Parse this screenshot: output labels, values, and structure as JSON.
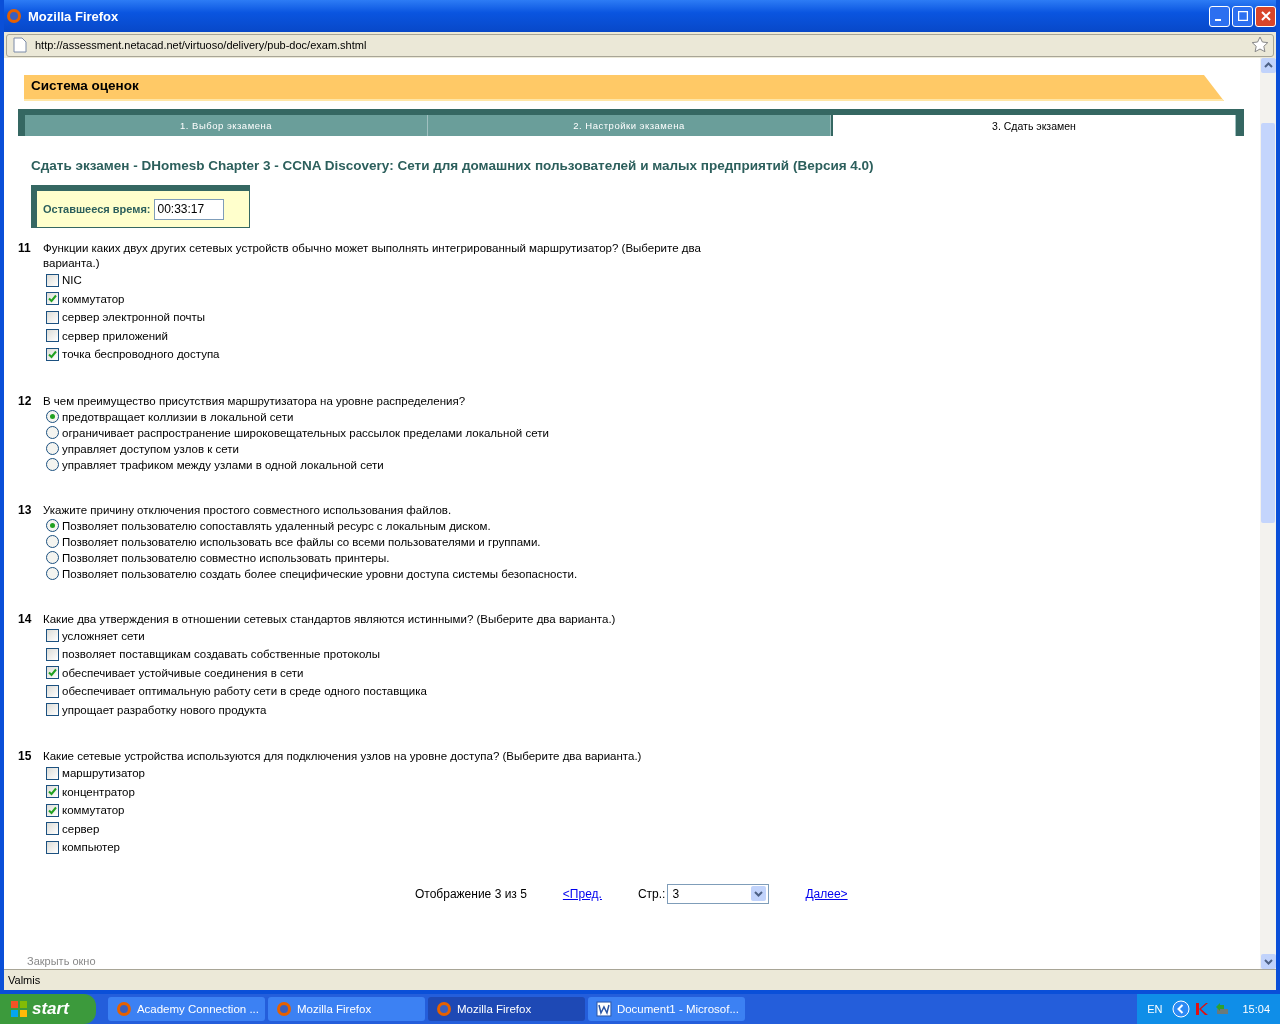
{
  "window": {
    "title": "Mozilla Firefox"
  },
  "address_bar": {
    "url": "http://assessment.netacad.net/virtuoso/delivery/pub-doc/exam.shtml"
  },
  "page": {
    "header": "Система оценок",
    "tabs": [
      {
        "label": "1. Выбор экзамена",
        "selected": false
      },
      {
        "label": "2. Настройки экзамена",
        "selected": false
      },
      {
        "label": "3. Сдать экзамен",
        "selected": true
      }
    ],
    "exam_title": "Сдать экзамен - DHomesb Chapter 3 - CCNA Discovery: Сети для домашних пользователей и малых предприятий (Версия 4.0)",
    "timer": {
      "label": "Оставшееся время:",
      "value": "00:33:17"
    },
    "questions": [
      {
        "number": "11",
        "kind": "checkbox",
        "text": "Функции каких двух других сетевых устройств обычно может выполнять интегрированный маршрутизатор? (Выберите два варианта.)",
        "options": [
          {
            "label": "NIC",
            "selected": false
          },
          {
            "label": "коммутатор",
            "selected": true
          },
          {
            "label": "сервер электронной почты",
            "selected": false
          },
          {
            "label": "сервер приложений",
            "selected": false
          },
          {
            "label": "точка беспроводного доступа",
            "selected": true
          }
        ]
      },
      {
        "number": "12",
        "kind": "radio",
        "text": "В чем преимущество присутствия маршрутизатора на уровне распределения?",
        "options": [
          {
            "label": "предотвращает коллизии в локальной сети",
            "selected": true
          },
          {
            "label": "ограничивает распространение широковещательных рассылок пределами локальной сети",
            "selected": false
          },
          {
            "label": "управляет доступом узлов к сети",
            "selected": false
          },
          {
            "label": "управляет трафиком между узлами в одной локальной сети",
            "selected": false
          }
        ]
      },
      {
        "number": "13",
        "kind": "radio",
        "text": "Укажите причину отключения простого совместного использования файлов.",
        "options": [
          {
            "label": "Позволяет пользователю сопоставлять удаленный ресурс с локальным диском.",
            "selected": true
          },
          {
            "label": "Позволяет пользователю использовать все файлы со всеми пользователями и группами.",
            "selected": false
          },
          {
            "label": "Позволяет пользователю совместно использовать принтеры.",
            "selected": false
          },
          {
            "label": "Позволяет пользователю создать более специфические уровни доступа системы безопасности.",
            "selected": false
          }
        ]
      },
      {
        "number": "14",
        "kind": "checkbox",
        "text": "Какие два утверждения в отношении сетевых стандартов являются истинными? (Выберите два варианта.)",
        "options": [
          {
            "label": "усложняет сети",
            "selected": false
          },
          {
            "label": "позволяет поставщикам создавать собственные протоколы",
            "selected": false
          },
          {
            "label": "обеспечивает устойчивые соединения в сети",
            "selected": true
          },
          {
            "label": "обеспечивает оптимальную работу сети в среде одного поставщика",
            "selected": false
          },
          {
            "label": "упрощает разработку нового продукта",
            "selected": false
          }
        ]
      },
      {
        "number": "15",
        "kind": "checkbox",
        "text": "Какие сетевые устройства используются для подключения узлов на уровне доступа? (Выберите два варианта.)",
        "options": [
          {
            "label": "маршрутизатор",
            "selected": false
          },
          {
            "label": "концентратор",
            "selected": true
          },
          {
            "label": "коммутатор",
            "selected": true
          },
          {
            "label": "сервер",
            "selected": false
          },
          {
            "label": "компьютер",
            "selected": false
          }
        ]
      }
    ],
    "pagination": {
      "status": "Отображение 3 из 5",
      "prev": "<Пред.",
      "page_label": "Стр.:",
      "page_value": "3",
      "next": "Далее>"
    },
    "close_link": "Закрыть окно"
  },
  "status_bar": {
    "text": "Valmis"
  },
  "taskbar": {
    "start": "start",
    "tasks": [
      {
        "label": "Academy Connection ...",
        "kind": "firefox",
        "selected": false
      },
      {
        "label": "Mozilla Firefox",
        "kind": "firefox",
        "selected": false
      },
      {
        "label": "Mozilla Firefox",
        "kind": "firefox",
        "selected": true
      },
      {
        "label": "Document1 - Microsof...",
        "kind": "word",
        "selected": false
      }
    ],
    "language": "EN",
    "clock": "15:04"
  }
}
